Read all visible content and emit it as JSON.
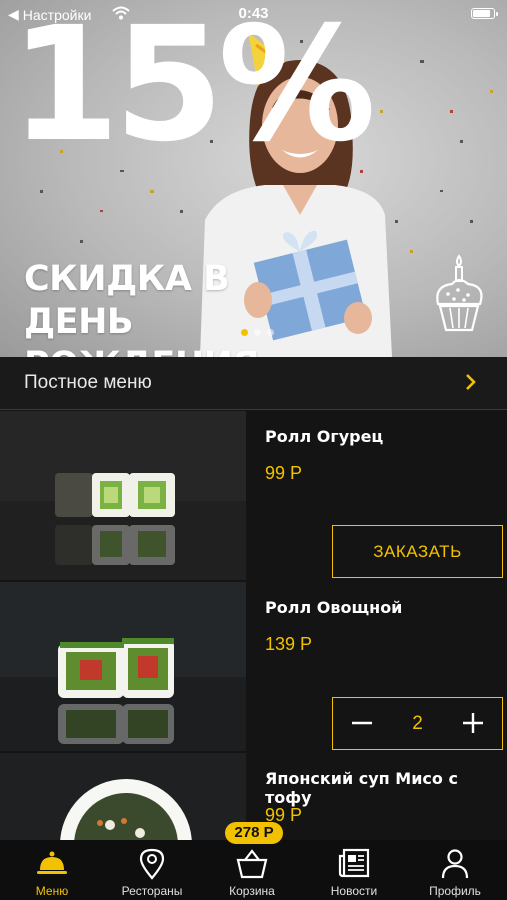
{
  "status_bar": {
    "back_app": "Настройки",
    "time": "0:43",
    "battery_level": 0.85
  },
  "banner": {
    "big_text": "15%",
    "headline": "СКИДКА В ДЕНЬ РОЖДЕНИЯ",
    "slides_total": 3,
    "slide_active": 1,
    "icon": "cupcake-icon"
  },
  "lent_menu": {
    "label": "Постное меню"
  },
  "products": [
    {
      "name": "Ролл Огурец",
      "price": "99 Р",
      "action": "order",
      "button_label": "ЗАКАЗАТЬ"
    },
    {
      "name": "Ролл Овощной",
      "price": "139 Р",
      "action": "stepper",
      "quantity": "2"
    },
    {
      "name": "Японский суп Мисо с тофу",
      "price": "99 Р"
    }
  ],
  "cart_badge": "278 Р",
  "tabs": [
    {
      "label": "Меню",
      "icon": "cloche-icon",
      "active": true
    },
    {
      "label": "Рестораны",
      "icon": "map-pin-icon",
      "active": false
    },
    {
      "label": "Корзина",
      "icon": "basket-icon",
      "active": false
    },
    {
      "label": "Новости",
      "icon": "newspaper-icon",
      "active": false
    },
    {
      "label": "Профиль",
      "icon": "person-icon",
      "active": false
    }
  ],
  "colors": {
    "accent": "#f2c200",
    "background": "#141414",
    "tabbar": "#0e0e0e"
  }
}
